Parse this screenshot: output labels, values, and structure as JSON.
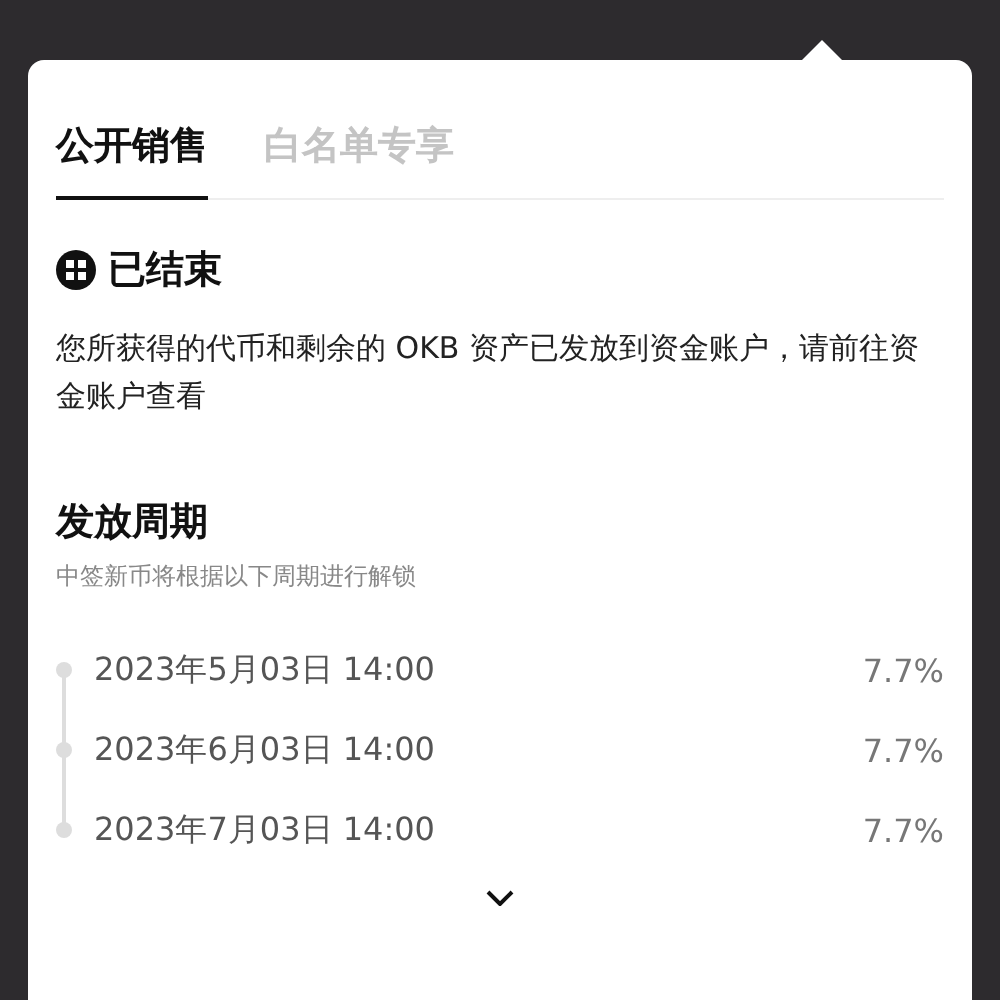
{
  "tabs": [
    {
      "label": "公开销售",
      "selected": true
    },
    {
      "label": "白名单专享",
      "selected": false
    }
  ],
  "status": {
    "title": "已结束",
    "description": "您所获得的代币和剩余的 OKB 资产已发放到资金账户，请前往资金账户查看"
  },
  "schedule": {
    "title": "发放周期",
    "subtitle": "中签新币将根据以下周期进行解锁",
    "items": [
      {
        "date": "2023年5月03日 14:00",
        "percent": "7.7%"
      },
      {
        "date": "2023年6月03日 14:00",
        "percent": "7.7%"
      },
      {
        "date": "2023年7月03日 14:00",
        "percent": "7.7%"
      }
    ],
    "expanded": false
  }
}
